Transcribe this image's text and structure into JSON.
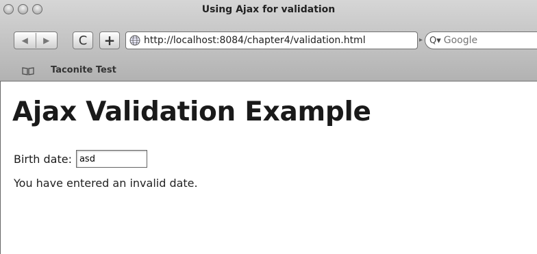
{
  "window": {
    "title": "Using Ajax for validation"
  },
  "toolbar": {
    "back_icon": "back-arrow-icon",
    "forward_icon": "forward-arrow-icon",
    "reload_glyph": "C",
    "add_glyph": "+",
    "url": "http://localhost:8084/chapter4/validation.html",
    "search_placeholder": "Google"
  },
  "bookmarks": {
    "items": [
      {
        "label": "Taconite Test"
      }
    ]
  },
  "page": {
    "heading": "Ajax Validation Example",
    "birth_date_label": "Birth date:",
    "birth_date_value": "asd",
    "validation_message": "You have entered an invalid date."
  }
}
